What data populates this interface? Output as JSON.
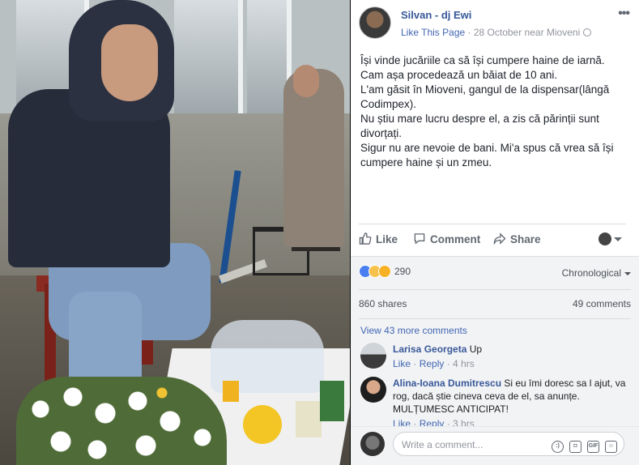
{
  "post": {
    "author": "Silvan - dj Ewi",
    "like_page": "Like This Page",
    "separator": " · ",
    "date_location": "28 October near Mioveni",
    "more": "•••",
    "text_lines": [
      "Își vinde jucăriile ca să își cumpere haine de iarnă.",
      "Cam așa procedează un băiat de 10 ani.",
      "L'am găsit în Mioveni, gangul de la dispensar(lângă Codimpex).",
      "Nu știu mare lucru despre el, a zis că părinții sunt divorțați.",
      "Sigur nu are nevoie de bani. Mi'a spus că vrea să își cumpere haine și un zmeu."
    ]
  },
  "actions": {
    "like": "Like",
    "comment": "Comment",
    "share": "Share"
  },
  "feedback": {
    "reaction_count": "290",
    "sort_label": "Chronological",
    "shares": "860 shares",
    "comments": "49 comments",
    "view_more": "View 43 more comments"
  },
  "comments": [
    {
      "name": "Larisa Georgeta",
      "text": "Up",
      "like": "Like",
      "reply": "Reply",
      "time": "4 hrs"
    },
    {
      "name": "Alina-Ioana Dumitrescu",
      "text": "Si eu îmi doresc sa l ajut, va rog, dacă știe cineva ceva de el, sa anunțe. MULȚUMESC ANTICIPAT!",
      "like": "Like",
      "reply": "Reply",
      "time": "3 hrs"
    }
  ],
  "composer": {
    "placeholder": "Write a comment..."
  },
  "icons": {
    "like": "thumbs-up-icon",
    "comment": "speech-bubble-icon",
    "share": "share-arrow-icon",
    "emoji": "smiley-icon",
    "camera": "camera-icon",
    "gif": "gif-icon",
    "sticker": "sticker-icon"
  },
  "colors": {
    "link_blue": "#365899",
    "action_gray": "#606770",
    "feedback_bg": "#f2f3f5"
  }
}
